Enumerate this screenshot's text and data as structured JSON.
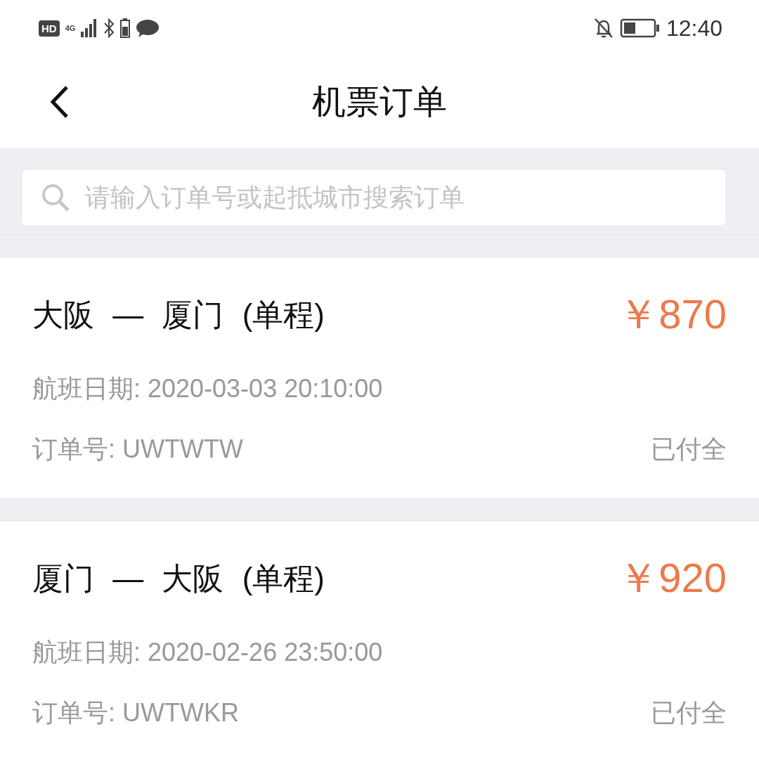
{
  "status_bar": {
    "left": [
      "HD",
      "4G"
    ],
    "time": "12:40"
  },
  "header": {
    "title": "机票订单"
  },
  "search": {
    "placeholder": "请输入订单号或起抵城市搜索订单"
  },
  "orders": [
    {
      "route": "大阪 — 厦门 (单程)",
      "price": "￥870",
      "date": "航班日期: 2020-03-03 20:10:00",
      "order_no": "订单号: UWTWTW",
      "status": "已付全"
    },
    {
      "route": "厦门 — 大阪 (单程)",
      "price": "￥920",
      "date": "航班日期: 2020-02-26 23:50:00",
      "order_no": "订单号: UWTWKR",
      "status": "已付全"
    }
  ]
}
